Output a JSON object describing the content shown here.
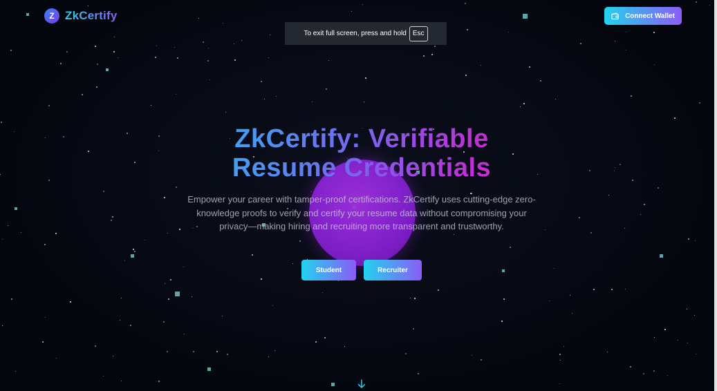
{
  "brand": {
    "badge_letter": "Z",
    "name": "ZkCertify"
  },
  "header": {
    "connect_wallet_label": "Connect Wallet",
    "wallet_icon": "wallet-icon"
  },
  "fullscreen_notice": {
    "text": "To exit full screen, press and hold",
    "key": "Esc"
  },
  "hero": {
    "title_line_1": "ZkCertify: Verifiable",
    "title_line_2": "Resume Credentials",
    "description": "Empower your career with tamper-proof certifications. ZkCertify uses cutting-edge zero-knowledge proofs to verify and certify your resume data without compromising your privacy—making hiring and recruiting more transparent and trustworthy.",
    "buttons": {
      "student": "Student",
      "recruiter": "Recruiter"
    },
    "scroll_icon": "arrow-down-icon"
  },
  "colors": {
    "background": "#060913",
    "accent_start": "#22d3ee",
    "accent_end": "#8b5cf6",
    "orb": "#9b2ee0",
    "star": "#7fd8d8"
  }
}
